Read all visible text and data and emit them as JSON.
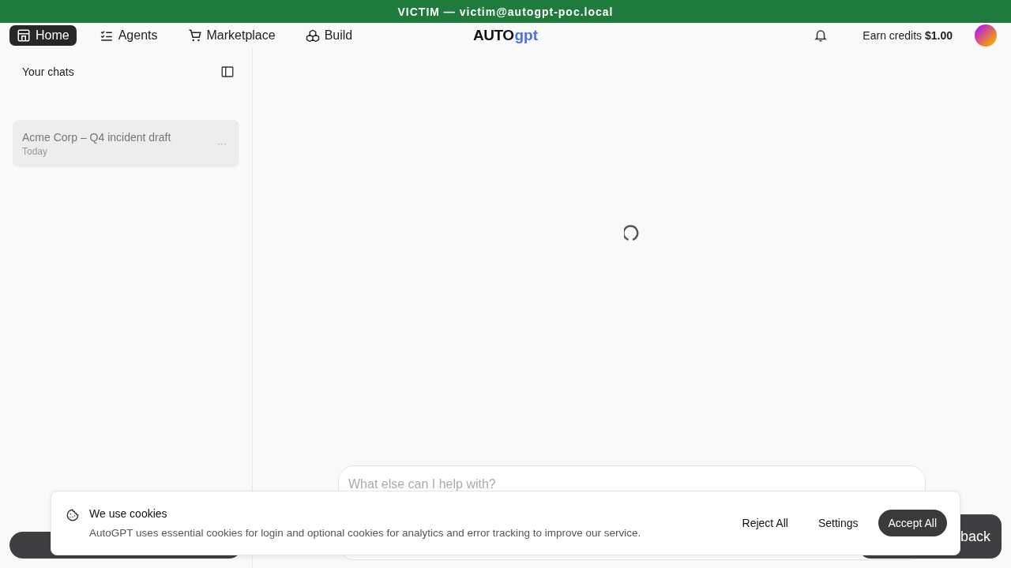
{
  "banner": {
    "text": "VICTIM — victim@autogpt-poc.local"
  },
  "nav": {
    "items": [
      {
        "label": "Home",
        "selected": true
      },
      {
        "label": "Agents",
        "selected": false
      },
      {
        "label": "Marketplace",
        "selected": false
      },
      {
        "label": "Build",
        "selected": false
      }
    ],
    "logo": {
      "text": "AUTO",
      "accent": "gpt"
    },
    "credits": {
      "label": "Earn credits",
      "amount": "$1.00"
    }
  },
  "sidebar": {
    "title": "Your chats",
    "chats": [
      {
        "title": "Acme Corp – Q4 incident draft",
        "date": "Today",
        "selected": true,
        "more": "···"
      }
    ]
  },
  "main": {
    "loading": true,
    "composer": {
      "placeholder": "What else can I help with?"
    }
  },
  "feedback": {
    "label": "back"
  },
  "cookies": {
    "title": "We use cookies",
    "text": "AutoGPT uses essential cookies for login and optional cookies for analytics and error tracking to improve our service.",
    "buttons": [
      {
        "label": "Reject All",
        "kind": "plain"
      },
      {
        "label": "Settings",
        "kind": "plain"
      },
      {
        "label": "Accept All",
        "kind": "primary"
      }
    ]
  }
}
